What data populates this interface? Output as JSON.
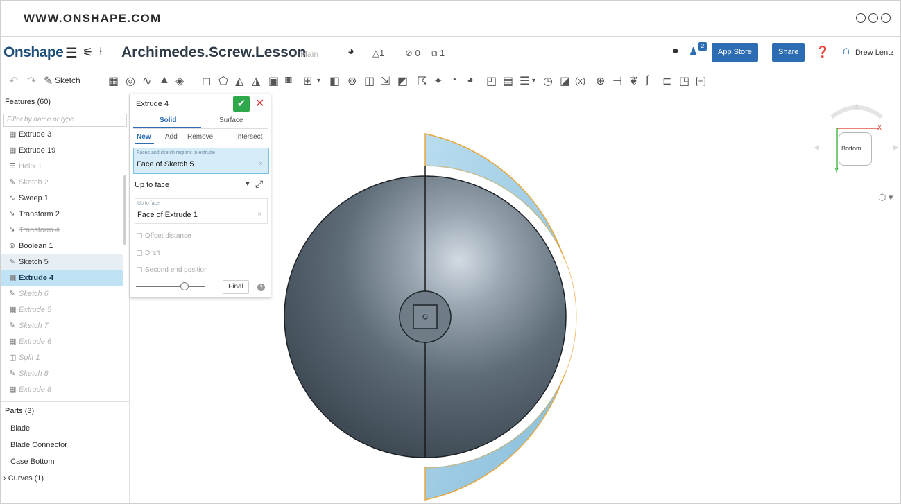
{
  "browser": {
    "url": "WWW.ONSHAPE.COM"
  },
  "header": {
    "logo": "Onshape",
    "menu_icon": "hamburger-icon",
    "title": "Archimedes.Screw.Lesson",
    "branch": "Main",
    "likes": "1",
    "links": "0",
    "copies": "1",
    "notification_count": "2",
    "app_store_label": "App Store",
    "share_label": "Share",
    "user_name": "Drew Lentz"
  },
  "toolbar": {
    "sketch_label": "Sketch",
    "variable_label": "(x)"
  },
  "features": {
    "title": "Features (60)",
    "filter_placeholder": "Filter by name or type",
    "items": [
      {
        "label": "Extrude 3",
        "icon": "extrude-icon"
      },
      {
        "label": "Extrude 19",
        "icon": "extrude-icon"
      },
      {
        "label": "Helix 1",
        "icon": "helix-icon"
      },
      {
        "label": "Sketch 2",
        "icon": "sketch-icon"
      },
      {
        "label": "Sweep 1",
        "icon": "sweep-icon"
      },
      {
        "label": "Transform 2",
        "icon": "transform-icon"
      },
      {
        "label": "Transform 4",
        "icon": "transform-icon"
      },
      {
        "label": "Boolean 1",
        "icon": "boolean-icon"
      },
      {
        "label": "Sketch 5",
        "icon": "sketch-icon"
      },
      {
        "label": "Extrude 4",
        "icon": "extrude-icon"
      },
      {
        "label": "Sketch 6",
        "icon": "sketch-icon"
      },
      {
        "label": "Extrude 5",
        "icon": "extrude-icon"
      },
      {
        "label": "Sketch 7",
        "icon": "sketch-icon"
      },
      {
        "label": "Extrude 6",
        "icon": "extrude-icon"
      },
      {
        "label": "Split 1",
        "icon": "split-icon"
      },
      {
        "label": "Sketch 8",
        "icon": "sketch-icon"
      },
      {
        "label": "Extrude 8",
        "icon": "extrude-icon"
      }
    ]
  },
  "parts": {
    "title": "Parts (3)",
    "items": [
      "Blade",
      "Blade Connector",
      "Case Bottom"
    ],
    "curves": "Curves (1)"
  },
  "dialog": {
    "title": "Extrude 4",
    "tabs": [
      "Solid",
      "Surface"
    ],
    "operations": [
      "New",
      "Add",
      "Remove",
      "Intersect"
    ],
    "faces_label": "Faces and sketch regions to extrude",
    "faces_value": "Face of Sketch 5",
    "end_type": "Up to face",
    "up_to_label": "Up to face",
    "up_to_value": "Face of Extrude 1",
    "offset_label": "Offset distance",
    "draft_label": "Draft",
    "second_end_label": "Second end position",
    "final_label": "Final"
  },
  "viewcube": {
    "face": "Bottom",
    "x_axis": "X",
    "y_axis": "Y"
  },
  "colors": {
    "accent": "#2b6cb3",
    "confirm": "#2da84a",
    "cancel": "#d33333",
    "selection": "#bfe3f5",
    "preview": "#a9d2e8",
    "edge_highlight": "#e8a63a"
  }
}
